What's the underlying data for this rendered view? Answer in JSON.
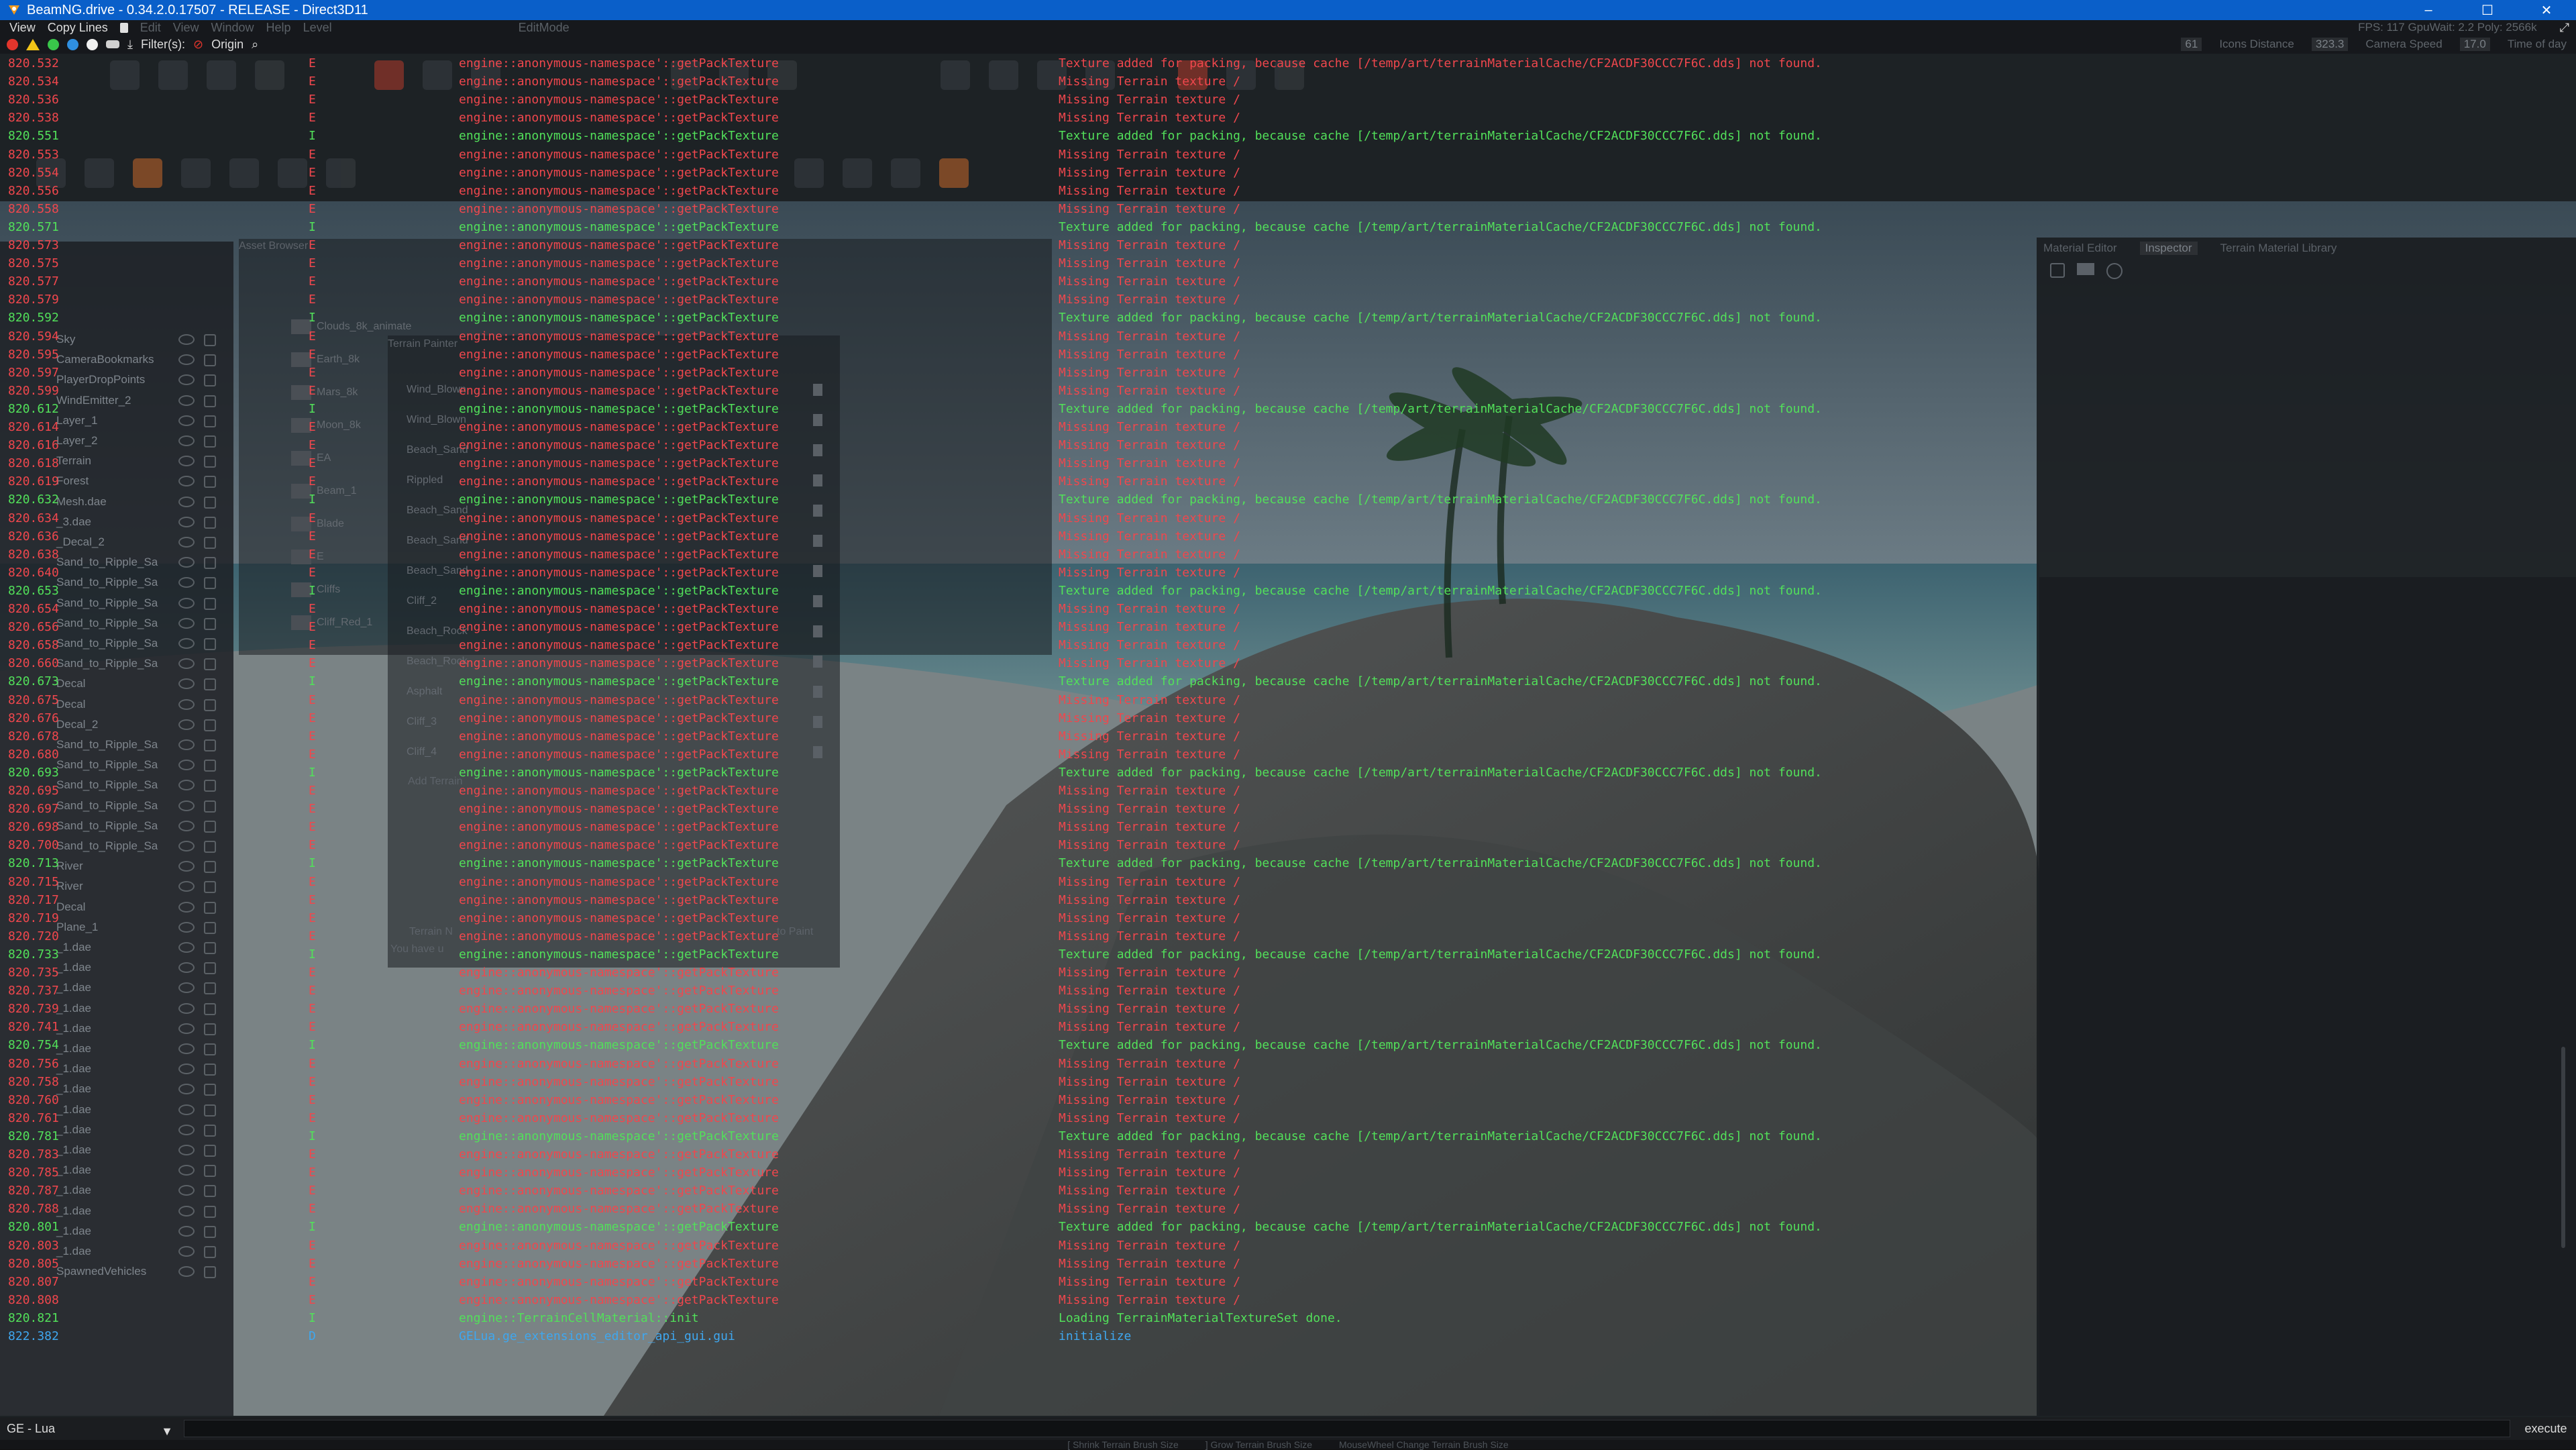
{
  "window": {
    "title": "BeamNG.drive - 0.34.2.0.17507 - RELEASE - Direct3D11",
    "controls": [
      "–",
      "☐",
      "✕"
    ]
  },
  "menu": {
    "items": [
      "View",
      "Copy Lines"
    ],
    "dim_items": [
      "Edit",
      "View",
      "Window",
      "Help",
      "Level",
      "EditMode"
    ],
    "right_status": "FPS: 117  GpuWait: 2.2  Poly: 2566k"
  },
  "console_toolbar": {
    "filters_label": "Filter(s):",
    "origin_label": "Origin",
    "right_labels": [
      "Icons Distance",
      "Camera Speed",
      "Time of day"
    ],
    "right_values": [
      "61",
      "323.3",
      "17.0"
    ]
  },
  "scene_tree": {
    "labels": [
      "Sky",
      "CameraBookmarks",
      "PlayerDropPoints",
      "WindEmitter_2",
      "Layer_1",
      "Layer_2",
      "Terrain",
      "Forest",
      "Mesh.dae",
      "_3.dae",
      "_Decal_2",
      "Sand_to_Ripple_Sa",
      "Sand_to_Ripple_Sa",
      "Sand_to_Ripple_Sa",
      "Sand_to_Ripple_Sa",
      "Sand_to_Ripple_Sa",
      "Sand_to_Ripple_Sa",
      "Decal",
      "Decal",
      "Decal_2",
      "Sand_to_Ripple_Sa",
      "Sand_to_Ripple_Sa",
      "Sand_to_Ripple_Sa",
      "Sand_to_Ripple_Sa",
      "Sand_to_Ripple_Sa",
      "Sand_to_Ripple_Sa",
      "River",
      "River",
      "Decal",
      "Plane_1",
      "_1.dae",
      "_1.dae",
      "_1.dae",
      "_1.dae",
      "_1.dae",
      "_1.dae",
      "_1.dae",
      "_1.dae",
      "_1.dae",
      "_1.dae",
      "_1.dae",
      "_1.dae",
      "_1.dae",
      "_1.dae",
      "_1.dae",
      "_1.dae",
      "SpawnedVehicles"
    ]
  },
  "asset_browser": {
    "title": "Asset Browser",
    "folders": [
      "Clouds_8k_animate",
      "Earth_8k",
      "Mars_8k",
      "Moon_8k",
      "EA",
      "Beam_1",
      "Blade",
      "E",
      "Cliffs",
      "Cliff_Red_1"
    ]
  },
  "terrain_painter": {
    "title": "Terrain Painter",
    "materials": [
      "Wind_Blown",
      "Wind_Blown",
      "Beach_Sand",
      "Rippled",
      "Beach_Sand",
      "Beach_Sand",
      "Beach_Sand",
      "Cliff_2",
      "Beach_Rock",
      "Beach_Rock",
      "Asphalt",
      "Cliff_3",
      "Cliff_4"
    ],
    "add_label": "Add Terrain",
    "footer": [
      "Terrain N",
      "You have u",
      "to Paint"
    ]
  },
  "right_panel": {
    "tabs": [
      "Material Editor",
      "Inspector",
      "Terrain Material Library"
    ]
  },
  "log": [
    {
      "t": "820.532",
      "l": "E",
      "o": "engine::anonymous-namespace'::getPackTexture",
      "m": "Texture added for packing, because cache [/temp/art/terrainMaterialCache/CF2ACDF30CCC7F6C.dds] not found."
    },
    {
      "t": "820.534",
      "l": "E",
      "o": "engine::anonymous-namespace'::getPackTexture",
      "m": "Missing Terrain texture /"
    },
    {
      "t": "820.536",
      "l": "E",
      "o": "engine::anonymous-namespace'::getPackTexture",
      "m": "Missing Terrain texture /"
    },
    {
      "t": "820.538",
      "l": "E",
      "o": "engine::anonymous-namespace'::getPackTexture",
      "m": "Missing Terrain texture /"
    },
    {
      "t": "820.551",
      "l": "I",
      "o": "engine::anonymous-namespace'::getPackTexture",
      "m": "Texture added for packing, because cache [/temp/art/terrainMaterialCache/CF2ACDF30CCC7F6C.dds] not found."
    },
    {
      "t": "820.553",
      "l": "E",
      "o": "engine::anonymous-namespace'::getPackTexture",
      "m": "Missing Terrain texture /"
    },
    {
      "t": "820.554",
      "l": "E",
      "o": "engine::anonymous-namespace'::getPackTexture",
      "m": "Missing Terrain texture /"
    },
    {
      "t": "820.556",
      "l": "E",
      "o": "engine::anonymous-namespace'::getPackTexture",
      "m": "Missing Terrain texture /"
    },
    {
      "t": "820.558",
      "l": "E",
      "o": "engine::anonymous-namespace'::getPackTexture",
      "m": "Missing Terrain texture /"
    },
    {
      "t": "820.571",
      "l": "I",
      "o": "engine::anonymous-namespace'::getPackTexture",
      "m": "Texture added for packing, because cache [/temp/art/terrainMaterialCache/CF2ACDF30CCC7F6C.dds] not found."
    },
    {
      "t": "820.573",
      "l": "E",
      "o": "engine::anonymous-namespace'::getPackTexture",
      "m": "Missing Terrain texture /"
    },
    {
      "t": "820.575",
      "l": "E",
      "o": "engine::anonymous-namespace'::getPackTexture",
      "m": "Missing Terrain texture /"
    },
    {
      "t": "820.577",
      "l": "E",
      "o": "engine::anonymous-namespace'::getPackTexture",
      "m": "Missing Terrain texture /"
    },
    {
      "t": "820.579",
      "l": "E",
      "o": "engine::anonymous-namespace'::getPackTexture",
      "m": "Missing Terrain texture /"
    },
    {
      "t": "820.592",
      "l": "I",
      "o": "engine::anonymous-namespace'::getPackTexture",
      "m": "Texture added for packing, because cache [/temp/art/terrainMaterialCache/CF2ACDF30CCC7F6C.dds] not found."
    },
    {
      "t": "820.594",
      "l": "E",
      "o": "engine::anonymous-namespace'::getPackTexture",
      "m": "Missing Terrain texture /"
    },
    {
      "t": "820.595",
      "l": "E",
      "o": "engine::anonymous-namespace'::getPackTexture",
      "m": "Missing Terrain texture /"
    },
    {
      "t": "820.597",
      "l": "E",
      "o": "engine::anonymous-namespace'::getPackTexture",
      "m": "Missing Terrain texture /"
    },
    {
      "t": "820.599",
      "l": "E",
      "o": "engine::anonymous-namespace'::getPackTexture",
      "m": "Missing Terrain texture /"
    },
    {
      "t": "820.612",
      "l": "I",
      "o": "engine::anonymous-namespace'::getPackTexture",
      "m": "Texture added for packing, because cache [/temp/art/terrainMaterialCache/CF2ACDF30CCC7F6C.dds] not found."
    },
    {
      "t": "820.614",
      "l": "E",
      "o": "engine::anonymous-namespace'::getPackTexture",
      "m": "Missing Terrain texture /"
    },
    {
      "t": "820.616",
      "l": "E",
      "o": "engine::anonymous-namespace'::getPackTexture",
      "m": "Missing Terrain texture /"
    },
    {
      "t": "820.618",
      "l": "E",
      "o": "engine::anonymous-namespace'::getPackTexture",
      "m": "Missing Terrain texture /"
    },
    {
      "t": "820.619",
      "l": "E",
      "o": "engine::anonymous-namespace'::getPackTexture",
      "m": "Missing Terrain texture /"
    },
    {
      "t": "820.632",
      "l": "I",
      "o": "engine::anonymous-namespace'::getPackTexture",
      "m": "Texture added for packing, because cache [/temp/art/terrainMaterialCache/CF2ACDF30CCC7F6C.dds] not found."
    },
    {
      "t": "820.634",
      "l": "E",
      "o": "engine::anonymous-namespace'::getPackTexture",
      "m": "Missing Terrain texture /"
    },
    {
      "t": "820.636",
      "l": "E",
      "o": "engine::anonymous-namespace'::getPackTexture",
      "m": "Missing Terrain texture /"
    },
    {
      "t": "820.638",
      "l": "E",
      "o": "engine::anonymous-namespace'::getPackTexture",
      "m": "Missing Terrain texture /"
    },
    {
      "t": "820.640",
      "l": "E",
      "o": "engine::anonymous-namespace'::getPackTexture",
      "m": "Missing Terrain texture /"
    },
    {
      "t": "820.653",
      "l": "I",
      "o": "engine::anonymous-namespace'::getPackTexture",
      "m": "Texture added for packing, because cache [/temp/art/terrainMaterialCache/CF2ACDF30CCC7F6C.dds] not found."
    },
    {
      "t": "820.654",
      "l": "E",
      "o": "engine::anonymous-namespace'::getPackTexture",
      "m": "Missing Terrain texture /"
    },
    {
      "t": "820.656",
      "l": "E",
      "o": "engine::anonymous-namespace'::getPackTexture",
      "m": "Missing Terrain texture /"
    },
    {
      "t": "820.658",
      "l": "E",
      "o": "engine::anonymous-namespace'::getPackTexture",
      "m": "Missing Terrain texture /"
    },
    {
      "t": "820.660",
      "l": "E",
      "o": "engine::anonymous-namespace'::getPackTexture",
      "m": "Missing Terrain texture /"
    },
    {
      "t": "820.673",
      "l": "I",
      "o": "engine::anonymous-namespace'::getPackTexture",
      "m": "Texture added for packing, because cache [/temp/art/terrainMaterialCache/CF2ACDF30CCC7F6C.dds] not found."
    },
    {
      "t": "820.675",
      "l": "E",
      "o": "engine::anonymous-namespace'::getPackTexture",
      "m": "Missing Terrain texture /"
    },
    {
      "t": "820.676",
      "l": "E",
      "o": "engine::anonymous-namespace'::getPackTexture",
      "m": "Missing Terrain texture /"
    },
    {
      "t": "820.678",
      "l": "E",
      "o": "engine::anonymous-namespace'::getPackTexture",
      "m": "Missing Terrain texture /"
    },
    {
      "t": "820.680",
      "l": "E",
      "o": "engine::anonymous-namespace'::getPackTexture",
      "m": "Missing Terrain texture /"
    },
    {
      "t": "820.693",
      "l": "I",
      "o": "engine::anonymous-namespace'::getPackTexture",
      "m": "Texture added for packing, because cache [/temp/art/terrainMaterialCache/CF2ACDF30CCC7F6C.dds] not found."
    },
    {
      "t": "820.695",
      "l": "E",
      "o": "engine::anonymous-namespace'::getPackTexture",
      "m": "Missing Terrain texture /"
    },
    {
      "t": "820.697",
      "l": "E",
      "o": "engine::anonymous-namespace'::getPackTexture",
      "m": "Missing Terrain texture /"
    },
    {
      "t": "820.698",
      "l": "E",
      "o": "engine::anonymous-namespace'::getPackTexture",
      "m": "Missing Terrain texture /"
    },
    {
      "t": "820.700",
      "l": "E",
      "o": "engine::anonymous-namespace'::getPackTexture",
      "m": "Missing Terrain texture /"
    },
    {
      "t": "820.713",
      "l": "I",
      "o": "engine::anonymous-namespace'::getPackTexture",
      "m": "Texture added for packing, because cache [/temp/art/terrainMaterialCache/CF2ACDF30CCC7F6C.dds] not found."
    },
    {
      "t": "820.715",
      "l": "E",
      "o": "engine::anonymous-namespace'::getPackTexture",
      "m": "Missing Terrain texture /"
    },
    {
      "t": "820.717",
      "l": "E",
      "o": "engine::anonymous-namespace'::getPackTexture",
      "m": "Missing Terrain texture /"
    },
    {
      "t": "820.719",
      "l": "E",
      "o": "engine::anonymous-namespace'::getPackTexture",
      "m": "Missing Terrain texture /"
    },
    {
      "t": "820.720",
      "l": "E",
      "o": "engine::anonymous-namespace'::getPackTexture",
      "m": "Missing Terrain texture /"
    },
    {
      "t": "820.733",
      "l": "I",
      "o": "engine::anonymous-namespace'::getPackTexture",
      "m": "Texture added for packing, because cache [/temp/art/terrainMaterialCache/CF2ACDF30CCC7F6C.dds] not found."
    },
    {
      "t": "820.735",
      "l": "E",
      "o": "engine::anonymous-namespace'::getPackTexture",
      "m": "Missing Terrain texture /"
    },
    {
      "t": "820.737",
      "l": "E",
      "o": "engine::anonymous-namespace'::getPackTexture",
      "m": "Missing Terrain texture /"
    },
    {
      "t": "820.739",
      "l": "E",
      "o": "engine::anonymous-namespace'::getPackTexture",
      "m": "Missing Terrain texture /"
    },
    {
      "t": "820.741",
      "l": "E",
      "o": "engine::anonymous-namespace'::getPackTexture",
      "m": "Missing Terrain texture /"
    },
    {
      "t": "820.754",
      "l": "I",
      "o": "engine::anonymous-namespace'::getPackTexture",
      "m": "Texture added for packing, because cache [/temp/art/terrainMaterialCache/CF2ACDF30CCC7F6C.dds] not found."
    },
    {
      "t": "820.756",
      "l": "E",
      "o": "engine::anonymous-namespace'::getPackTexture",
      "m": "Missing Terrain texture /"
    },
    {
      "t": "820.758",
      "l": "E",
      "o": "engine::anonymous-namespace'::getPackTexture",
      "m": "Missing Terrain texture /"
    },
    {
      "t": "820.760",
      "l": "E",
      "o": "engine::anonymous-namespace'::getPackTexture",
      "m": "Missing Terrain texture /"
    },
    {
      "t": "820.761",
      "l": "E",
      "o": "engine::anonymous-namespace'::getPackTexture",
      "m": "Missing Terrain texture /"
    },
    {
      "t": "820.781",
      "l": "I",
      "o": "engine::anonymous-namespace'::getPackTexture",
      "m": "Texture added for packing, because cache [/temp/art/terrainMaterialCache/CF2ACDF30CCC7F6C.dds] not found."
    },
    {
      "t": "820.783",
      "l": "E",
      "o": "engine::anonymous-namespace'::getPackTexture",
      "m": "Missing Terrain texture /"
    },
    {
      "t": "820.785",
      "l": "E",
      "o": "engine::anonymous-namespace'::getPackTexture",
      "m": "Missing Terrain texture /"
    },
    {
      "t": "820.787",
      "l": "E",
      "o": "engine::anonymous-namespace'::getPackTexture",
      "m": "Missing Terrain texture /"
    },
    {
      "t": "820.788",
      "l": "E",
      "o": "engine::anonymous-namespace'::getPackTexture",
      "m": "Missing Terrain texture /"
    },
    {
      "t": "820.801",
      "l": "I",
      "o": "engine::anonymous-namespace'::getPackTexture",
      "m": "Texture added for packing, because cache [/temp/art/terrainMaterialCache/CF2ACDF30CCC7F6C.dds] not found."
    },
    {
      "t": "820.803",
      "l": "E",
      "o": "engine::anonymous-namespace'::getPackTexture",
      "m": "Missing Terrain texture /"
    },
    {
      "t": "820.805",
      "l": "E",
      "o": "engine::anonymous-namespace'::getPackTexture",
      "m": "Missing Terrain texture /"
    },
    {
      "t": "820.807",
      "l": "E",
      "o": "engine::anonymous-namespace'::getPackTexture",
      "m": "Missing Terrain texture /"
    },
    {
      "t": "820.808",
      "l": "E",
      "o": "engine::anonymous-namespace'::getPackTexture",
      "m": "Missing Terrain texture /"
    },
    {
      "t": "820.821",
      "l": "I",
      "o": "engine::TerrainCellMaterial::init",
      "m": "Loading TerrainMaterialTextureSet done."
    },
    {
      "t": "822.382",
      "l": "D",
      "o": "GELua.ge_extensions_editor_api_gui.gui",
      "m": "initialize"
    }
  ],
  "level_colors": {
    "E": "#f0474d",
    "I": "#52e05a",
    "D": "#3fa7ef"
  },
  "command_bar": {
    "context": "GE - Lua",
    "execute_label": "execute"
  },
  "status_hints": [
    "[ Shrink Terrain Brush Size",
    "] Grow Terrain Brush Size",
    "MouseWheel  Change Terrain Brush Size"
  ]
}
